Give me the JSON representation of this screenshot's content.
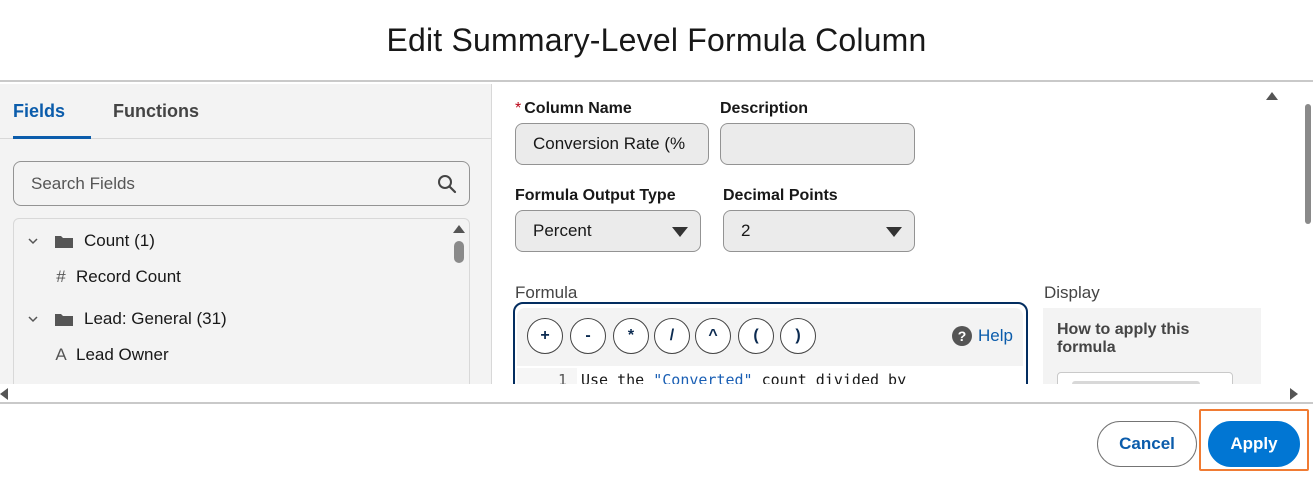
{
  "modal": {
    "title": "Edit Summary-Level Formula Column"
  },
  "left_panel": {
    "tabs": [
      {
        "label": "Fields",
        "active": true
      },
      {
        "label": "Functions",
        "active": false
      }
    ],
    "search": {
      "placeholder": "Search Fields",
      "icon": "search-icon"
    },
    "tree": [
      {
        "type": "folder",
        "label": "Count (1)",
        "expanded": true
      },
      {
        "type": "leaf",
        "glyph": "#",
        "label": "Record Count"
      },
      {
        "type": "folder",
        "label": "Lead: General (31)",
        "expanded": true
      },
      {
        "type": "leaf",
        "glyph": "A",
        "label": "Lead Owner"
      }
    ]
  },
  "form": {
    "column_name": {
      "label": "Column Name",
      "required_mark": "*",
      "value": "Conversion Rate (%"
    },
    "description": {
      "label": "Description",
      "value": ""
    },
    "output_type": {
      "label": "Formula Output Type",
      "value": "Percent"
    },
    "decimal_points": {
      "label": "Decimal Points",
      "value": "2"
    },
    "formula": {
      "label": "Formula",
      "operators": [
        "+",
        "-",
        "*",
        "/",
        "^",
        "(",
        ")"
      ],
      "help_label": "Help",
      "line_number": "1",
      "code_prefix": "Use the ",
      "code_string": "\"Converted\"",
      "code_suffix": " count divided by"
    },
    "display": {
      "label": "Display",
      "title": "How to apply this formula"
    }
  },
  "footer": {
    "cancel_label": "Cancel",
    "apply_label": "Apply"
  },
  "colors": {
    "brand": "#0176d3",
    "active_tab": "#0b5cab",
    "highlight": "#f07b33",
    "editor_border": "#032d60"
  }
}
